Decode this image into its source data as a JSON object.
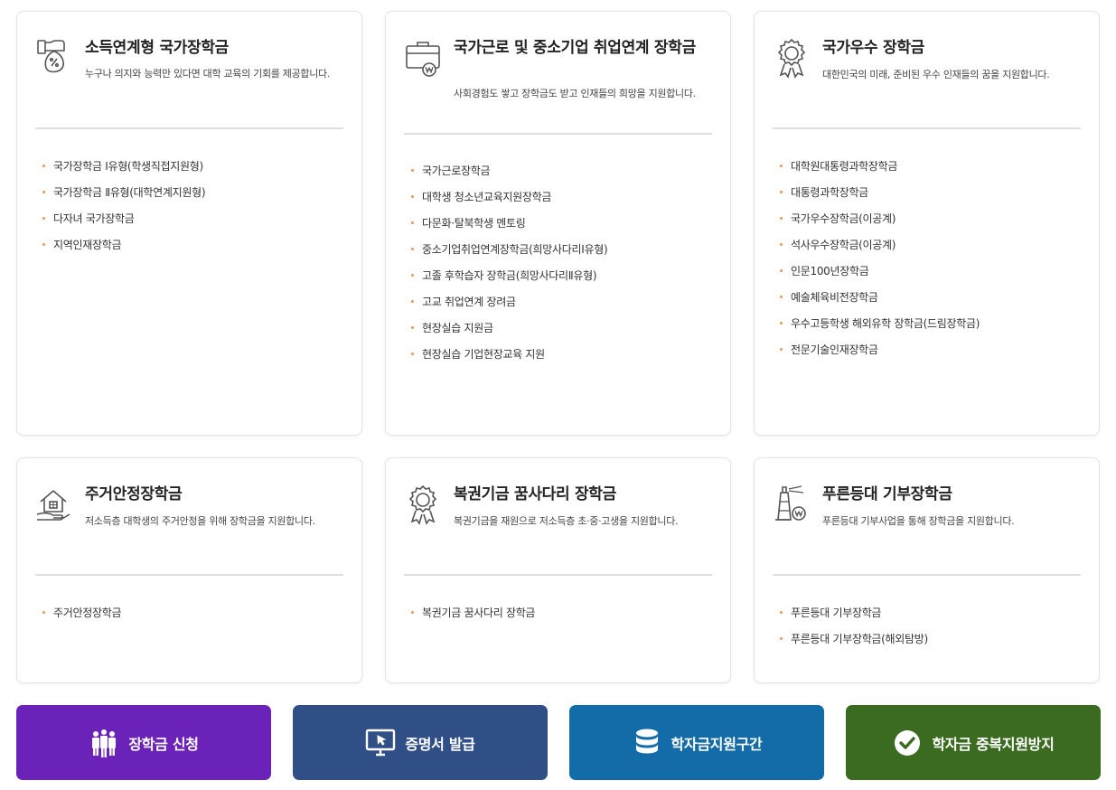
{
  "cards": [
    {
      "title": "소득연계형 국가장학금",
      "desc": "누구나 의지와 능력만 있다면 대학 교육의 기회를 제공합니다.",
      "items": [
        "국가장학금 Ⅰ유형(학생직접지원형)",
        "국가장학금 Ⅱ유형(대학연계지원형)",
        "다자녀 국가장학금",
        "지역인재장학금"
      ]
    },
    {
      "title": "국가근로 및 중소기업 취업연계 장학금",
      "desc": "사회경험도 쌓고 장학금도 받고 인재들의 희망을 지원합니다.",
      "items": [
        "국가근로장학금",
        "대학생 청소년교육지원장학금",
        "다문화·탈북학생 멘토링",
        "중소기업취업연계장학금(희망사다리Ⅰ유형)",
        "고졸 후학습자 장학금(희망사다리Ⅱ유형)",
        "고교 취업연계 장려금",
        "현장실습 지원금",
        "현장실습 기업현장교육 지원"
      ]
    },
    {
      "title": "국가우수 장학금",
      "desc": "대한민국의 미래, 준비된 우수 인재들의 꿈을 지원합니다.",
      "items": [
        "대학원대통령과학장학금",
        "대통령과학장학금",
        "국가우수장학금(이공계)",
        "석사우수장학금(이공계)",
        "인문100년장학금",
        "예술체육비전장학금",
        "우수고등학생 해외유학 장학금(드림장학금)",
        "전문기술인재장학금"
      ]
    },
    {
      "title": "주거안정장학금",
      "desc": "저소득층 대학생의 주거안정을 위해 장학금을 지원합니다.",
      "items": [
        "주거안정장학금"
      ]
    },
    {
      "title": "복권기금 꿈사다리 장학금",
      "desc": "복권기금을 재원으로 저소득층 초·중·고생을 지원합니다.",
      "items": [
        "복권기금 꿈사다리 장학금"
      ]
    },
    {
      "title": "푸른등대 기부장학금",
      "desc": "푸른등대 기부사업을 통해 장학금을 지원합니다.",
      "items": [
        "푸른등대 기부장학금",
        "푸른등대 기부장학금(해외탐방)"
      ]
    }
  ],
  "icons": [
    "money-percent-icon",
    "briefcase-won-icon",
    "award-medal-icon",
    "house-hand-icon",
    "award-medal-icon",
    "lighthouse-won-icon"
  ],
  "buttons": [
    {
      "label": "장학금 신청",
      "icon": "people-group-icon",
      "color": "#6a22b8"
    },
    {
      "label": "증명서 발급",
      "icon": "monitor-cursor-icon",
      "color": "#2f4f86"
    },
    {
      "label": "학자금지원구간",
      "icon": "database-stack-icon",
      "color": "#136ca8"
    },
    {
      "label": "학자금 중복지원방지",
      "icon": "check-circle-icon",
      "color": "#3a6b21"
    }
  ]
}
